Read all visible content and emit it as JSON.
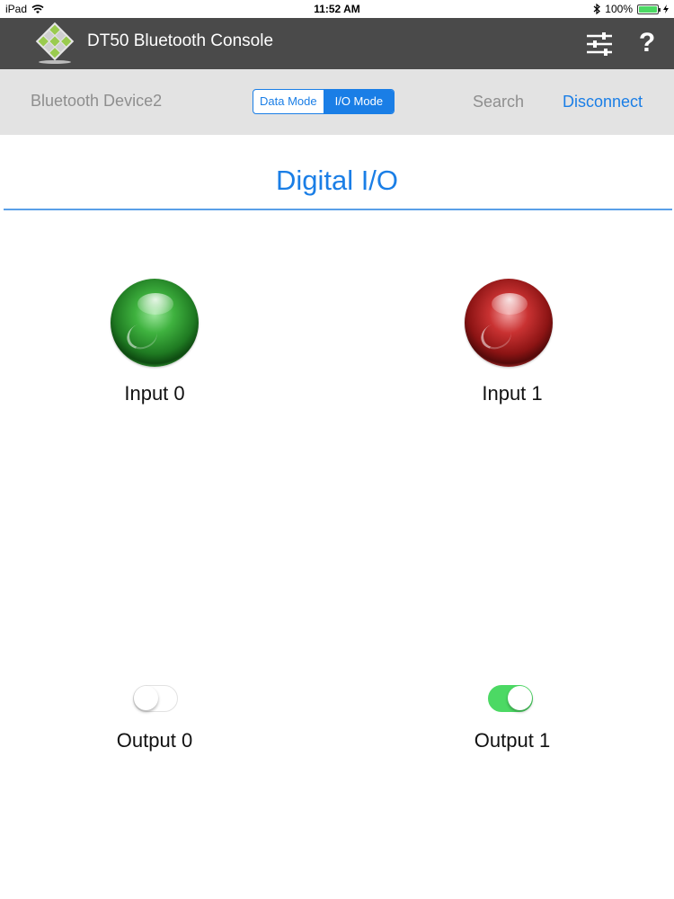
{
  "status_bar": {
    "device": "iPad",
    "time": "11:52 AM",
    "battery_percent": "100%",
    "battery_level": 1.0
  },
  "header": {
    "title": "DT50 Bluetooth Console",
    "icons": [
      "app-logo-icon",
      "settings-sliders-icon",
      "help-icon"
    ],
    "help_glyph": "?"
  },
  "toolbar": {
    "device_name": "Bluetooth Device2",
    "modes": [
      {
        "label": "Data Mode",
        "selected": false
      },
      {
        "label": "I/O Mode",
        "selected": true
      }
    ],
    "search_label": "Search",
    "disconnect_label": "Disconnect"
  },
  "main": {
    "title": "Digital I/O",
    "inputs": [
      {
        "label": "Input 0",
        "state": "on",
        "color": "#3fb23f"
      },
      {
        "label": "Input 1",
        "state": "off",
        "color": "#c93232"
      }
    ],
    "outputs": [
      {
        "label": "Output 0",
        "on": false
      },
      {
        "label": "Output 1",
        "on": true
      }
    ]
  },
  "colors": {
    "accent": "#1a7ee6",
    "header_bg": "#4a4a4a",
    "toolbar_bg": "#e3e3e3",
    "toggle_on": "#4cd964"
  }
}
